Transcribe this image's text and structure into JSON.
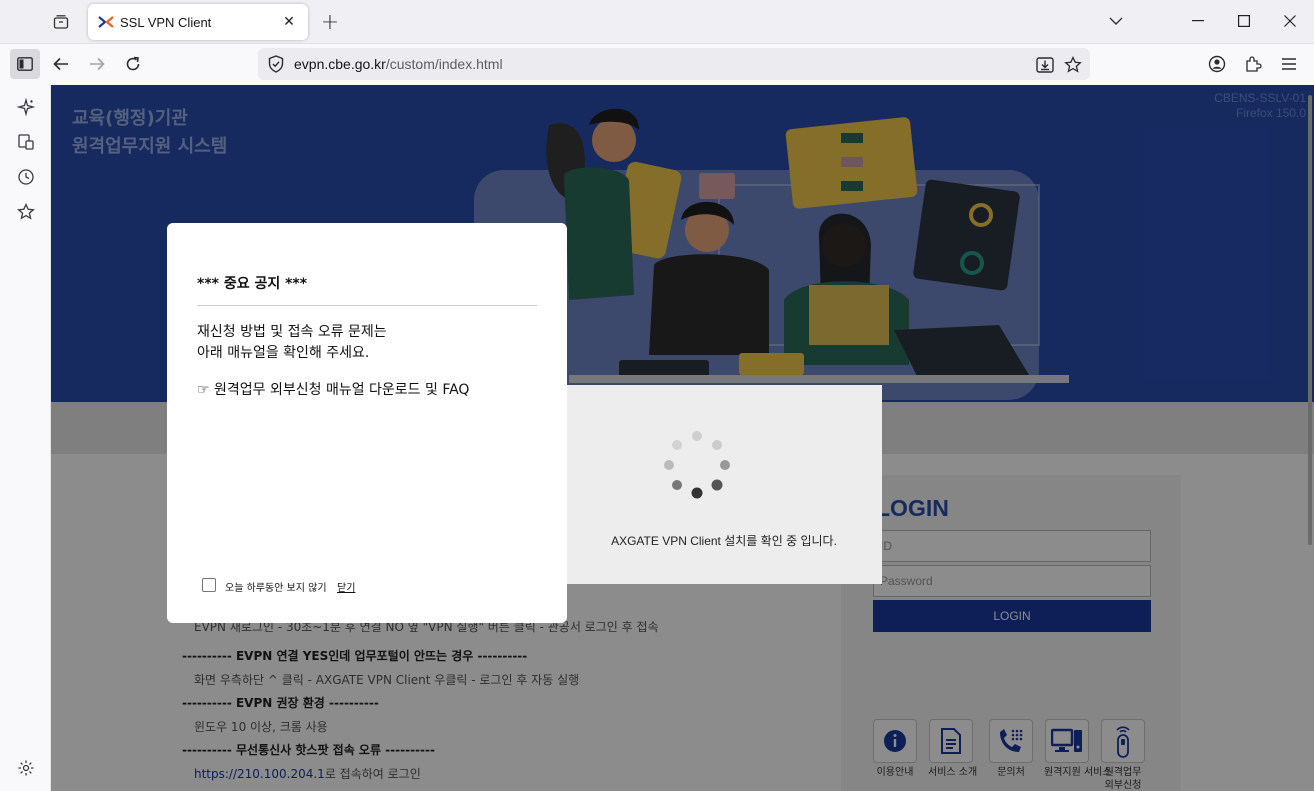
{
  "browser": {
    "tab_title": "SSL VPN Client",
    "url_host": "evpn.cbe.go.kr",
    "url_path": "/custom/index.html"
  },
  "hero": {
    "title_line1": "교육(행정)기관",
    "title_line2": "원격업무지원 시스템",
    "version_line1": "CBENS-SSLV-01",
    "version_line2": "Firefox 150.0"
  },
  "login": {
    "title": "LOGIN",
    "id_placeholder": "ID",
    "password_placeholder": "Password",
    "button_label": "LOGIN"
  },
  "quick_links": [
    {
      "label": "이용안내",
      "icon": "info-icon"
    },
    {
      "label": "서비스 소개",
      "icon": "document-icon"
    },
    {
      "label": "문의처",
      "icon": "phone-icon"
    },
    {
      "label": "원격지원\n서비스",
      "icon": "remote-desktop-icon"
    },
    {
      "label": "원격업무\n외부신청",
      "icon": "remote-control-icon"
    }
  ],
  "notices": [
    {
      "head": "",
      "body": "EVPN 재로그인 - 30초~1분 후 연결 NO 옆 \"VPN 실행\" 버튼 클릭 - 관공서 로그인 후 접속"
    },
    {
      "head": "---------- EVPN 연결 YES인데 업무포털이 안뜨는 경우 ----------",
      "body": "화면 우측하단 ^ 클릭 - AXGATE VPN Client 우클릭 - 로그인 후 자동 실행"
    },
    {
      "head": "---------- EVPN 권장 환경 ----------",
      "body": "윈도우 10 이상, 크롬 사용"
    },
    {
      "head": "---------- 무선통신사 핫스팟 접속 오류 ----------",
      "body_link": "https://210.100.204.1",
      "body": "로 접속하여 로그인"
    }
  ],
  "loading": {
    "message": "AXGATE VPN Client 설치를 확인 중 입니다."
  },
  "popup": {
    "title": "*** 중요 공지 ***",
    "line1": "재신청 방법 및 접속 오류 문제는",
    "line2": "아래 매뉴얼을 확인해 주세요.",
    "manual_link": "☞ 원격업무 외부신청 매뉴얼 다운로드 및 FAQ",
    "checkbox_label": "오늘 하루동안 보지 않기",
    "close_label": "닫기"
  }
}
